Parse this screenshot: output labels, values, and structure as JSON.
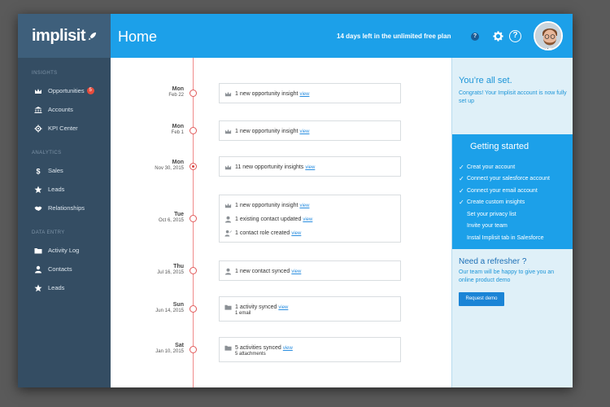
{
  "brand": {
    "logo": "implisit"
  },
  "sidebar": {
    "sections": [
      {
        "heading": "INSIGHTS",
        "items": [
          {
            "icon": "crown-icon",
            "label": "Opportunities",
            "badge": "5"
          },
          {
            "icon": "bank-icon",
            "label": "Accounts"
          },
          {
            "icon": "crosshair-icon",
            "label": "KPI Center"
          }
        ]
      },
      {
        "heading": "ANALYTICS",
        "items": [
          {
            "icon": "dollar-icon",
            "label": "Sales"
          },
          {
            "icon": "star-icon",
            "label": "Leads"
          },
          {
            "icon": "handshake-icon",
            "label": "Relationships"
          }
        ]
      },
      {
        "heading": "DATA ENTRY",
        "items": [
          {
            "icon": "folder-icon",
            "label": "Activity Log"
          },
          {
            "icon": "person-icon",
            "label": "Contacts"
          },
          {
            "icon": "star-icon",
            "label": "Leads"
          }
        ]
      }
    ]
  },
  "header": {
    "title": "Home",
    "trial": "14  days left in the unlimited free plan",
    "help": "?",
    "question": "?"
  },
  "timeline": [
    {
      "day": "Mon",
      "date": "Feb 22",
      "active": false,
      "lines": [
        {
          "icon": "crown-icon",
          "text": "1 new opportunity insight",
          "link": "view"
        }
      ]
    },
    {
      "day": "Mon",
      "date": "Feb 1",
      "active": false,
      "lines": [
        {
          "icon": "crown-icon",
          "text": "1 new opportunity insight",
          "link": "view"
        }
      ]
    },
    {
      "day": "Mon",
      "date": "Nov 30, 2015",
      "active": true,
      "lines": [
        {
          "icon": "crown-icon",
          "text": "11 new opportunity insights",
          "link": "view"
        }
      ]
    },
    {
      "day": "Tue",
      "date": "Oct 6, 2015",
      "active": false,
      "lines": [
        {
          "icon": "crown-icon",
          "text": "1 new opportunity insight",
          "link": "view"
        },
        {
          "icon": "person-icon",
          "text": "1 existing contact updated",
          "link": "view"
        },
        {
          "icon": "person-edit-icon",
          "text": "1 contact role created",
          "link": "view"
        }
      ]
    },
    {
      "day": "Thu",
      "date": "Jul 16, 2015",
      "active": false,
      "lines": [
        {
          "icon": "person-icon",
          "text": "1 new contact synced",
          "link": "view"
        }
      ]
    },
    {
      "day": "Sun",
      "date": "Jun 14, 2015",
      "active": false,
      "lines": [
        {
          "icon": "folder-icon",
          "text": "1 activity synced",
          "link": "view",
          "sub": "1 email"
        }
      ]
    },
    {
      "day": "Sat",
      "date": "Jan 10, 2015",
      "active": false,
      "lines": [
        {
          "icon": "folder-icon",
          "text": "5 activities synced",
          "link": "view",
          "sub": "5 attachments"
        }
      ]
    }
  ],
  "right_panel": {
    "title": "You’re all set.",
    "text": "Congrats! Your Implisit account is now fully set up",
    "getting_started": {
      "title": "Getting started",
      "items": [
        {
          "label": "Creat your account",
          "done": true
        },
        {
          "label": "Connect your salesforce account",
          "done": true
        },
        {
          "label": "Connect your email account",
          "done": true
        },
        {
          "label": "Create custom insights",
          "done": true
        },
        {
          "label": "Set your privacy list",
          "done": false
        },
        {
          "label": "Invite your team",
          "done": false
        },
        {
          "label": "Instal Implisit tab in Salesforce",
          "done": false
        }
      ]
    },
    "refresher_title": "Need a refresher ?",
    "refresher_text": "Our team will be happy to give you an online product demo",
    "demo_button": "Request demo"
  },
  "colors": {
    "topbar": "#1ca0e9",
    "sidebar": "#344d63",
    "accent_red": "#e05a5a",
    "link": "#2a8ee0"
  }
}
